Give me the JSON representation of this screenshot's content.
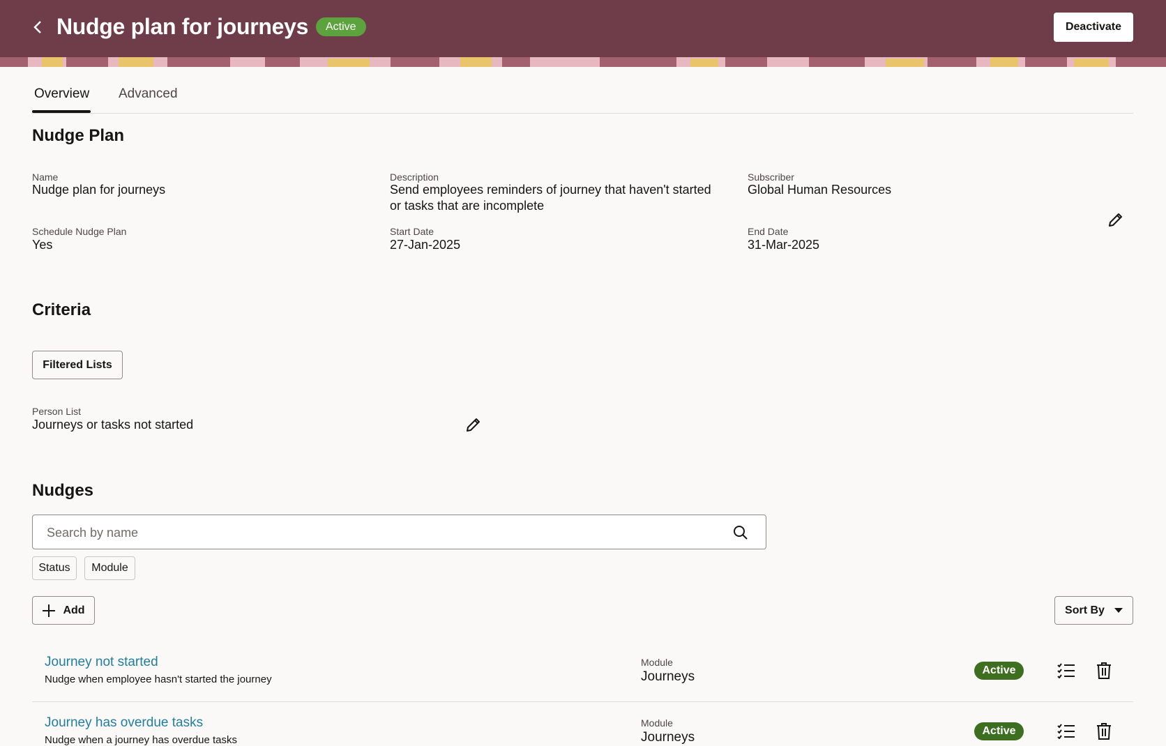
{
  "header": {
    "title": "Nudge plan for journeys",
    "status": "Active",
    "deactivate_label": "Deactivate",
    "colors": {
      "background": "#6f3d4a",
      "status_badge": "#5ca33d"
    }
  },
  "tabs": [
    {
      "label": "Overview",
      "active": true
    },
    {
      "label": "Advanced",
      "active": false
    }
  ],
  "nudge_plan": {
    "section_title": "Nudge Plan",
    "fields": {
      "name": {
        "label": "Name",
        "value": "Nudge plan for journeys"
      },
      "description": {
        "label": "Description",
        "value_line1": "Send employees reminders of journey that haven't started",
        "value_line2": "or tasks that are incomplete"
      },
      "subscriber": {
        "label": "Subscriber",
        "value": "Global Human Resources"
      },
      "schedule": {
        "label": "Schedule Nudge Plan",
        "value": "Yes"
      },
      "start_date": {
        "label": "Start Date",
        "value": "27-Jan-2025"
      },
      "end_date": {
        "label": "End Date",
        "value": "31-Mar-2025"
      }
    }
  },
  "criteria": {
    "section_title": "Criteria",
    "filtered_lists_label": "Filtered Lists",
    "person_list": {
      "label": "Person List",
      "value": "Journeys or tasks not started"
    }
  },
  "nudges": {
    "section_title": "Nudges",
    "search_placeholder": "Search by name",
    "filters": [
      "Status",
      "Module"
    ],
    "add_label": "Add",
    "sort_label": "Sort By",
    "items": [
      {
        "title": "Journey not started",
        "description": "Nudge when employee hasn't started the journey",
        "module_label": "Module",
        "module": "Journeys",
        "status": "Active"
      },
      {
        "title": "Journey has overdue tasks",
        "description": "Nudge when a journey has overdue tasks",
        "module_label": "Module",
        "module": "Journeys",
        "status": "Active"
      }
    ],
    "colors": {
      "link": "#227e9e",
      "status_badge": "#3e6f21"
    }
  }
}
